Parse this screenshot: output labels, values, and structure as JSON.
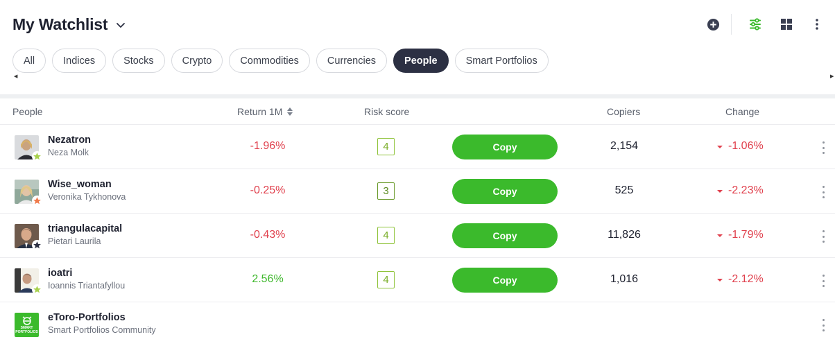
{
  "header": {
    "title": "My Watchlist",
    "icons": [
      "add-icon",
      "filters-icon",
      "grid-view-icon",
      "more-vertical-icon"
    ],
    "accent_color": "#3bba2c"
  },
  "tabs": [
    {
      "label": "All",
      "active": false
    },
    {
      "label": "Indices",
      "active": false
    },
    {
      "label": "Stocks",
      "active": false
    },
    {
      "label": "Crypto",
      "active": false
    },
    {
      "label": "Commodities",
      "active": false
    },
    {
      "label": "Currencies",
      "active": false
    },
    {
      "label": "People",
      "active": true
    },
    {
      "label": "Smart Portfolios",
      "active": false
    }
  ],
  "columns": {
    "people": "People",
    "return": "Return 1M",
    "risk": "Risk score",
    "copiers": "Copiers",
    "change": "Change"
  },
  "rows": [
    {
      "username": "Nezatron",
      "fullname": "Neza Molk",
      "return": "-1.96%",
      "risk": "4",
      "copy": "Copy",
      "copiers": "2,154",
      "change": "-1.06%",
      "star_color": "#a8d14d"
    },
    {
      "username": "Wise_woman",
      "fullname": "Veronika Tykhonova",
      "return": "-0.25%",
      "risk": "3",
      "copy": "Copy",
      "copiers": "525",
      "change": "-2.23%",
      "star_color": "#f07a4a"
    },
    {
      "username": "triangulacapital",
      "fullname": "Pietari Laurila",
      "return": "-0.43%",
      "risk": "4",
      "copy": "Copy",
      "copiers": "11,826",
      "change": "-1.79%",
      "star_color": "#2c3043"
    },
    {
      "username": "ioatri",
      "fullname": "Ioannis Triantafyllou",
      "return": "2.56%",
      "risk": "4",
      "copy": "Copy",
      "copiers": "1,016",
      "change": "-2.12%",
      "star_color": "#a8d14d"
    },
    {
      "username": "eToro-Portfolios",
      "fullname": "Smart Portfolios Community",
      "logo_text_1": "SMART",
      "logo_text_2": "PORTFOLIOS"
    }
  ],
  "colors": {
    "negative": "#e0404d",
    "positive": "#40b82e",
    "copy_button": "#3bba2c",
    "active_tab": "#2c3043"
  }
}
